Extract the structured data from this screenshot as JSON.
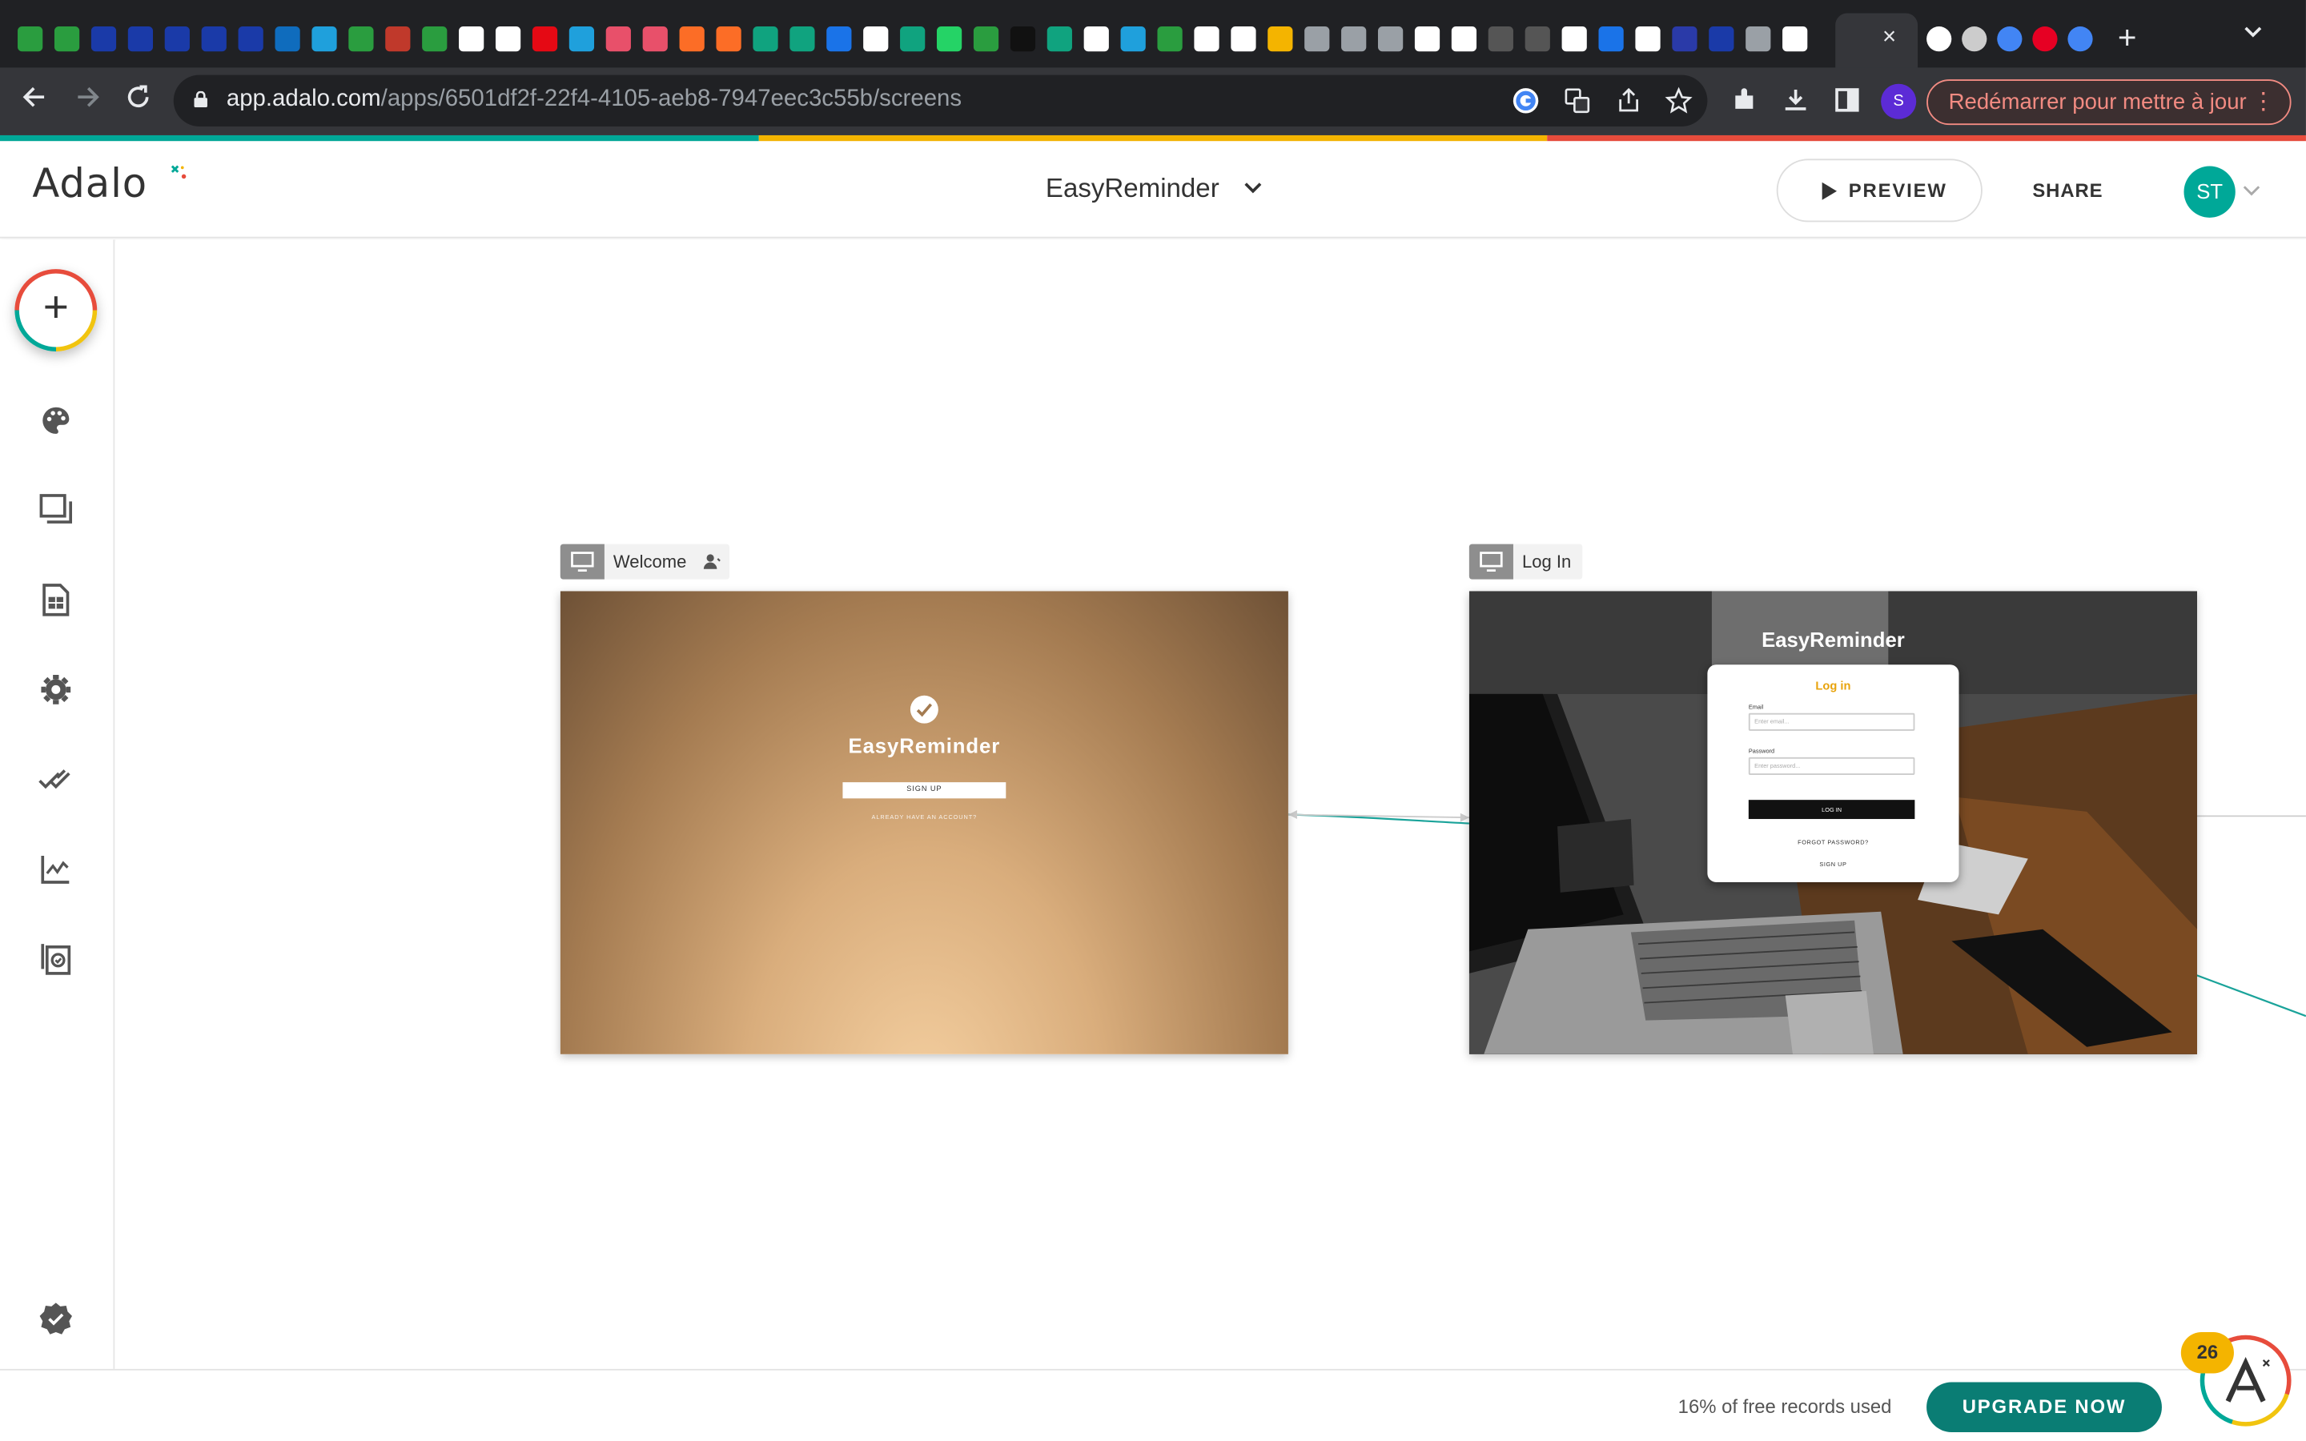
{
  "browser": {
    "tab_close": "×",
    "new_tab": "+",
    "url_domain": "app.adalo.com",
    "url_path": "/apps/6501df2f-22f4-4105-aeb8-7947eec3c55b/screens",
    "profile_initial": "S",
    "update_label": "Redémarrer pour mettre à jour",
    "update_menu": "⋮"
  },
  "header": {
    "logo_text": "Adalo",
    "app_name": "EasyReminder",
    "preview_label": "PREVIEW",
    "share_label": "SHARE",
    "avatar_initials": "ST"
  },
  "sidebar": {
    "add_label": "+",
    "items": [
      {
        "icon": "palette-icon"
      },
      {
        "icon": "screens-icon"
      },
      {
        "icon": "database-icon"
      },
      {
        "icon": "settings-icon"
      },
      {
        "icon": "publish-icon"
      },
      {
        "icon": "analytics-icon"
      },
      {
        "icon": "version-icon"
      },
      {
        "icon": "checklist-icon"
      }
    ]
  },
  "screens": [
    {
      "name": "Welcome",
      "title": "EasyReminder",
      "signup": "SIGN UP",
      "already": "ALREADY HAVE AN ACCOUNT?"
    },
    {
      "name": "Log In",
      "title": "EasyReminder",
      "card_heading": "Log in",
      "email_label": "Email",
      "email_placeholder": "Enter email...",
      "password_label": "Password",
      "password_placeholder": "Enter password...",
      "login_button": "LOG IN",
      "forgot": "FORGOT PASSWORD?",
      "signup": "SIGN UP"
    }
  ],
  "footer": {
    "usage_text": "16% of free records used",
    "upgrade_label": "UPGRADE NOW",
    "notification_count": "26"
  },
  "colors": {
    "accent_teal": "#00a898",
    "upgrade_green": "#0a7d74",
    "login_heading": "#e8a30c",
    "badge_yellow": "#f4b400"
  }
}
